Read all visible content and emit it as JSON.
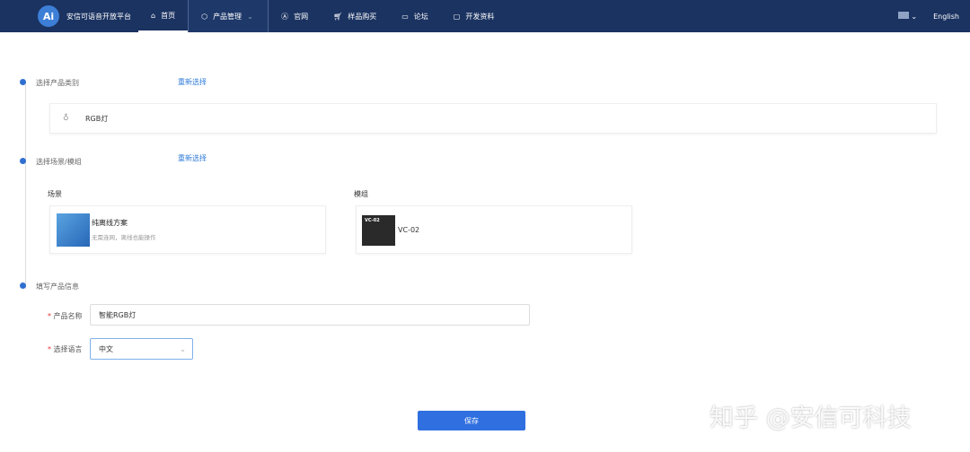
{
  "nav": {
    "logo": "Ai",
    "brand": "安信可语音开放平台",
    "items": [
      {
        "label": "首页",
        "icon": "home-icon"
      },
      {
        "label": "产品管理",
        "icon": "box-icon"
      },
      {
        "label": "官网",
        "icon": "ai-icon"
      },
      {
        "label": "样品购买",
        "icon": "cart-icon"
      },
      {
        "label": "论坛",
        "icon": "chat-icon"
      },
      {
        "label": "开发资料",
        "icon": "doc-icon"
      }
    ],
    "lang": "English"
  },
  "steps": [
    {
      "label": "选择产品类别",
      "reset": "重新选择"
    },
    {
      "label": "选择场景/模组",
      "reset": "重新选择"
    },
    {
      "label": "填写产品信息"
    }
  ],
  "category": {
    "name": "RGB灯"
  },
  "scene": {
    "header": "场景",
    "title": "纯离线方案",
    "desc": "无需连网，离线也能操作"
  },
  "module": {
    "header": "模组",
    "name": "VC-02",
    "chip_text": "VC-02"
  },
  "form": {
    "name_label": "产品名称",
    "name_value": "智能RGB灯",
    "lang_label": "选择语言",
    "lang_value": "中文",
    "required_mark": "*"
  },
  "save": "保存",
  "watermark": "知乎 @安信可科技"
}
